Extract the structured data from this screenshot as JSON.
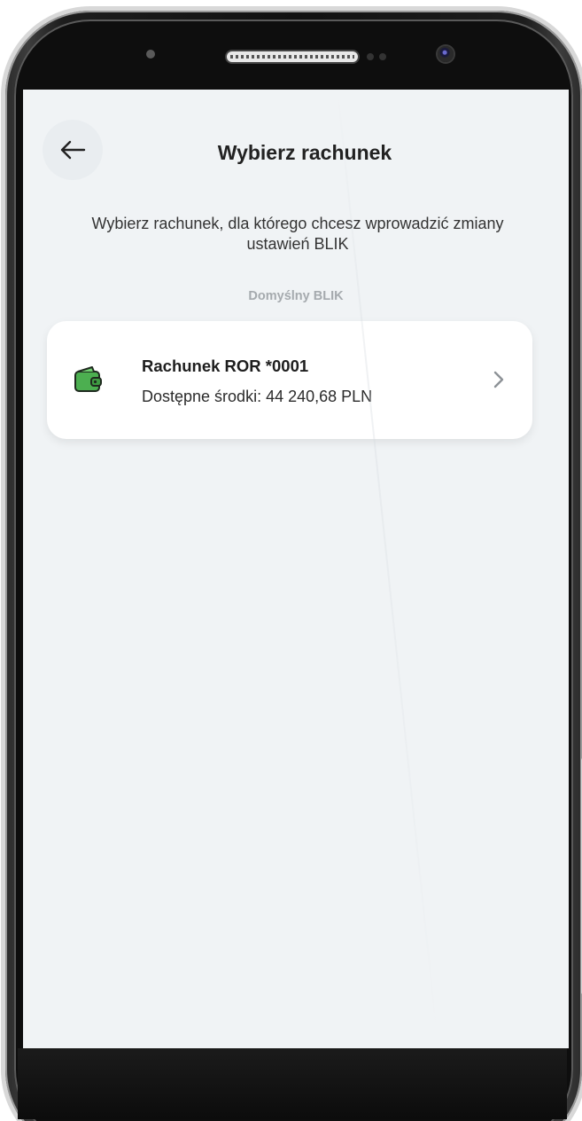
{
  "header": {
    "title": "Wybierz rachunek",
    "back_icon": "arrow-left-icon"
  },
  "description": "Wybierz rachunek, dla którego chcesz wprowadzić zmiany ustawień BLIK",
  "section_label": "Domyślny BLIK",
  "account": {
    "name": "Rachunek ROR *0001",
    "balance": "Dostępne środki: 44 240,68 PLN",
    "icon": "wallet-icon",
    "action_icon": "chevron-right-icon"
  },
  "colors": {
    "screen_background": "#f0f3f5",
    "card_background": "#ffffff",
    "wallet_green": "#4caf50",
    "section_label": "#a5aaae"
  }
}
